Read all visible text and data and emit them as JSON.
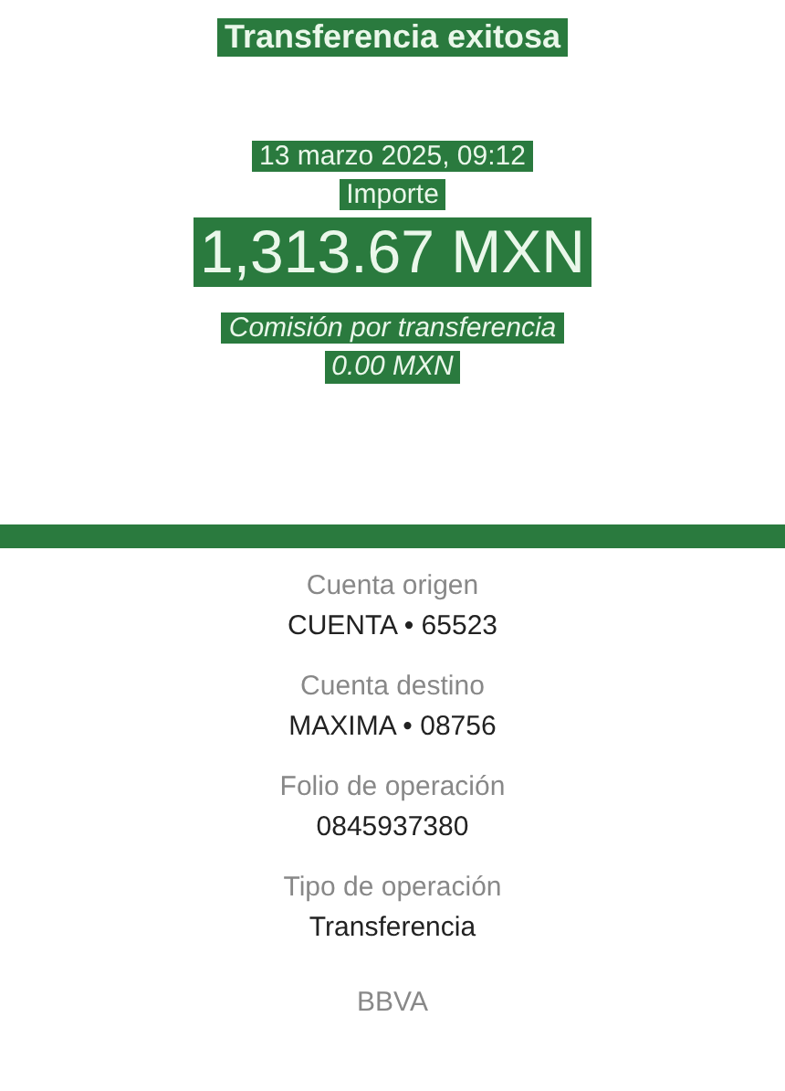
{
  "header": {
    "title": "Transferencia exitosa",
    "date": "13 marzo 2025, 09:12",
    "amount_label": "Importe",
    "amount": "1,313.67 MXN",
    "fee_label": "Comisión por transferencia",
    "fee": "0.00 MXN"
  },
  "details": [
    {
      "label": "Cuenta origen",
      "value": "CUENTA • 65523"
    },
    {
      "label": "Cuenta destino",
      "value": "MAXIMA • 08756"
    },
    {
      "label": "Folio de operación",
      "value": "0845937380"
    },
    {
      "label": "Tipo de operación",
      "value": "Transferencia"
    }
  ],
  "bank": "BBVA"
}
